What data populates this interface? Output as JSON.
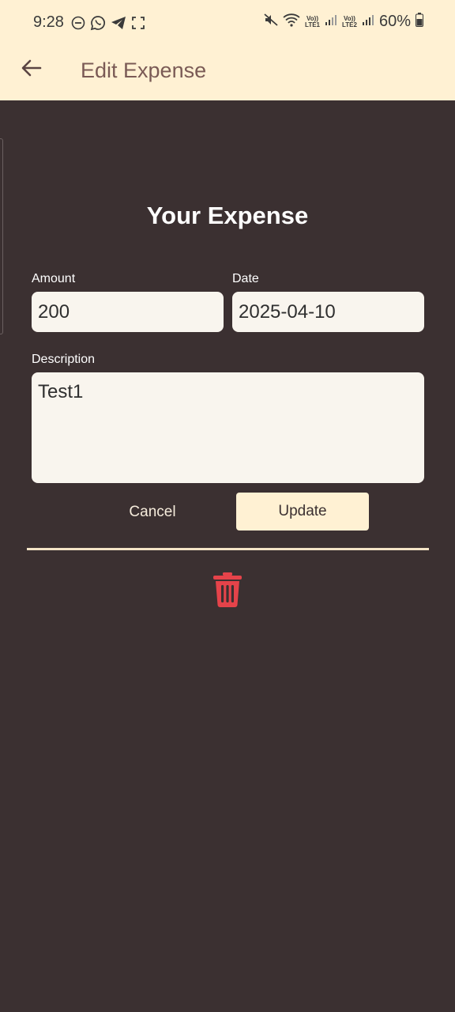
{
  "status_bar": {
    "time": "9:28",
    "left_icons": [
      "do-not-disturb-icon",
      "whatsapp-icon",
      "telegram-icon",
      "screenshot-icon"
    ],
    "right_icons": [
      "mute-icon",
      "wifi-icon",
      "signal-sim1-icon",
      "signal-sim2-icon",
      "battery-icon"
    ],
    "sim1_label_top": "Vo))",
    "sim1_label_bottom": "LTE1",
    "sim2_label_top": "Vo))",
    "sim2_label_bottom": "LTE2",
    "battery": "60%"
  },
  "app_bar": {
    "back_icon": "arrow-left-icon",
    "title": "Edit Expense"
  },
  "form": {
    "heading": "Your Expense",
    "amount_label": "Amount",
    "amount_value": "200",
    "date_label": "Date",
    "date_value": "2025-04-10",
    "description_label": "Description",
    "description_value": "Test1",
    "cancel_label": "Cancel",
    "update_label": "Update",
    "delete_icon": "trash-icon"
  },
  "colors": {
    "background": "#3b3031",
    "app_bar": "#fff1d3",
    "title": "#7a5a55",
    "field_bg": "#f9f5ee",
    "delete": "#e5434a"
  }
}
